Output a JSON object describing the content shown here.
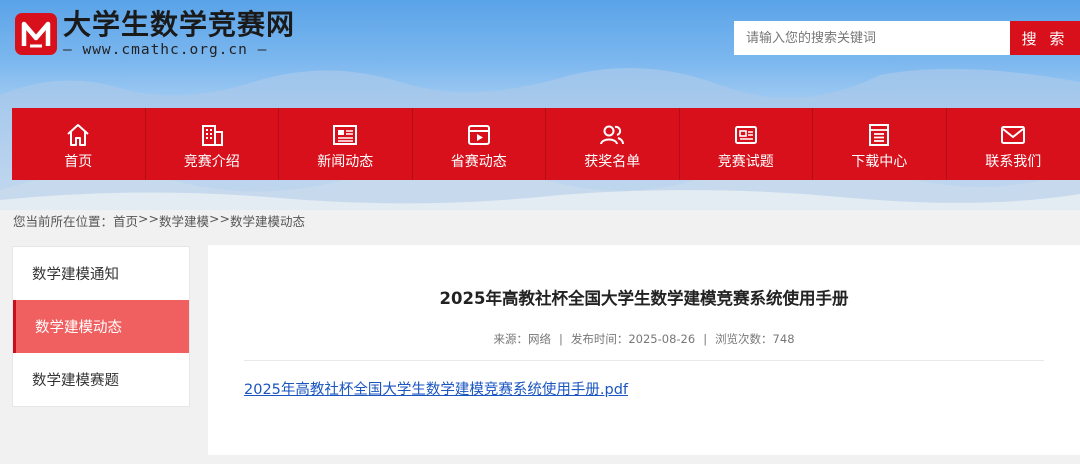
{
  "header": {
    "site_title": "大学生数学竞赛网",
    "site_url": "— www.cmathc.org.cn —",
    "logo_icon": "cm-logo-icon",
    "brand_color": "#d7101c"
  },
  "search": {
    "placeholder": "请输入您的搜索关键词",
    "button_label": "搜 索"
  },
  "nav": {
    "items": [
      {
        "label": "首页",
        "icon": "home-icon"
      },
      {
        "label": "竞赛介绍",
        "icon": "building-icon"
      },
      {
        "label": "新闻动态",
        "icon": "newspaper-icon"
      },
      {
        "label": "省赛动态",
        "icon": "video-play-icon"
      },
      {
        "label": "获奖名单",
        "icon": "users-icon"
      },
      {
        "label": "竞赛试题",
        "icon": "id-card-icon"
      },
      {
        "label": "下载中心",
        "icon": "document-list-icon"
      },
      {
        "label": "联系我们",
        "icon": "mail-icon"
      }
    ]
  },
  "breadcrumb": {
    "prefix": "您当前所在位置：",
    "home": "首页",
    "sep": ">>",
    "level1": "数学建模",
    "level2": "数学建模动态"
  },
  "sidebar": {
    "items": [
      {
        "label": "数学建模通知",
        "active": false
      },
      {
        "label": "数学建模动态",
        "active": true
      },
      {
        "label": "数学建模赛题",
        "active": false
      }
    ]
  },
  "article": {
    "title": "2025年高教社杯全国大学生数学建模竞赛系统使用手册",
    "source": "来源：网络",
    "date": "发布时间：2025-08-26",
    "views": "浏览次数：748",
    "sep": "|",
    "attachment": "2025年高教社杯全国大学生数学建模竞赛系统使用手册.pdf"
  }
}
